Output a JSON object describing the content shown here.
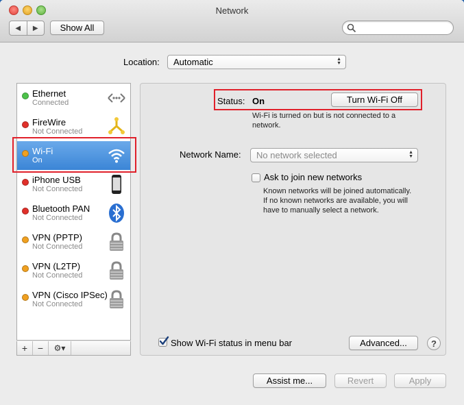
{
  "window": {
    "title": "Network"
  },
  "toolbar": {
    "back_glyph": "◀",
    "forward_glyph": "▶",
    "show_all": "Show All",
    "search_placeholder": ""
  },
  "location": {
    "label": "Location:",
    "value": "Automatic"
  },
  "services": [
    {
      "name": "Ethernet",
      "status": "Connected",
      "dot_color": "#4cc24a",
      "icon": "ethernet-icon"
    },
    {
      "name": "FireWire",
      "status": "Not Connected",
      "dot_color": "#e0302a",
      "icon": "firewire-icon"
    },
    {
      "name": "Wi-Fi",
      "status": "On",
      "dot_color": "#f0a020",
      "icon": "wifi-icon",
      "selected": true
    },
    {
      "name": "iPhone USB",
      "status": "Not Connected",
      "dot_color": "#e0302a",
      "icon": "iphone-icon"
    },
    {
      "name": "Bluetooth PAN",
      "status": "Not Connected",
      "dot_color": "#e0302a",
      "icon": "bluetooth-icon"
    },
    {
      "name": "VPN (PPTP)",
      "status": "Not Connected",
      "dot_color": "#f0a020",
      "icon": "lock-icon"
    },
    {
      "name": "VPN (L2TP)",
      "status": "Not Connected",
      "dot_color": "#f0a020",
      "icon": "lock-icon"
    },
    {
      "name": "VPN (Cisco IPSec)",
      "status": "Not Connected",
      "dot_color": "#f0a020",
      "icon": "lock-icon"
    }
  ],
  "sidebar_controls": {
    "add": "+",
    "remove": "−",
    "gear": "⚙▾"
  },
  "detail": {
    "status_label": "Status:",
    "status_value": "On",
    "toggle_button": "Turn Wi-Fi Off",
    "status_desc_line1": "Wi-Fi is turned on but is not connected to a",
    "status_desc_line2": "network.",
    "network_name_label": "Network Name:",
    "network_name_placeholder": "No network selected",
    "ask_join_label": "Ask to join new networks",
    "ask_join_checked": false,
    "ask_desc_line1": "Known networks will be joined automatically.",
    "ask_desc_line2": "If no known networks are available, you will",
    "ask_desc_line3": "have to manually select a network.",
    "show_status_label": "Show Wi-Fi status in menu bar",
    "show_status_checked": true,
    "advanced_button": "Advanced...",
    "help_glyph": "?"
  },
  "footer": {
    "assist": "Assist me...",
    "revert": "Revert",
    "apply": "Apply"
  },
  "colors": {
    "highlight": "#e0202a",
    "selection": "#3b85d6"
  }
}
